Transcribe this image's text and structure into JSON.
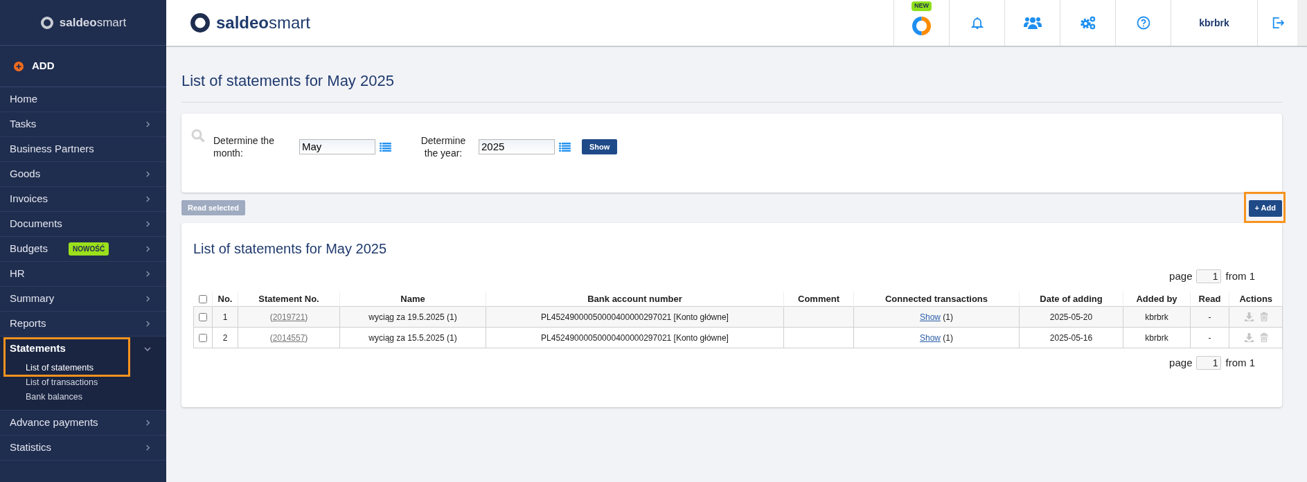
{
  "sidebar": {
    "logo": "**saldeo**smart",
    "add_label": "ADD",
    "items": [
      {
        "label": "Home",
        "has_arrow": false,
        "expanded": false,
        "highlighted": false
      },
      {
        "label": "Tasks",
        "has_arrow": true,
        "expanded": false,
        "highlighted": false
      },
      {
        "label": "Business Partners",
        "has_arrow": false,
        "expanded": false,
        "highlighted": false
      },
      {
        "label": "Goods",
        "has_arrow": true,
        "expanded": false,
        "highlighted": false
      },
      {
        "label": "Invoices",
        "has_arrow": true,
        "expanded": false,
        "highlighted": false
      },
      {
        "label": "Documents",
        "has_arrow": true,
        "expanded": false,
        "highlighted": false
      },
      {
        "label": "Budgets",
        "badge": "NOWOŚĆ",
        "has_arrow": true,
        "expanded": false,
        "highlighted": false
      },
      {
        "label": "HR",
        "has_arrow": true,
        "expanded": false,
        "highlighted": false
      },
      {
        "label": "Summary",
        "has_arrow": true,
        "expanded": false,
        "highlighted": false
      },
      {
        "label": "Reports",
        "has_arrow": true,
        "expanded": false,
        "highlighted": false
      },
      {
        "label": "Statements",
        "has_arrow": true,
        "expanded": true,
        "highlighted": true,
        "children": [
          {
            "label": "List of statements",
            "selected": true
          },
          {
            "label": "List of transactions",
            "selected": false
          },
          {
            "label": "Bank balances",
            "selected": false
          }
        ]
      },
      {
        "label": "Advance payments",
        "has_arrow": true,
        "expanded": false,
        "highlighted": false
      },
      {
        "label": "Statistics",
        "has_arrow": true,
        "expanded": false,
        "highlighted": false
      }
    ]
  },
  "header": {
    "logo": "**saldeo**smart",
    "new_badge": "NEW",
    "username": "kbrbrk"
  },
  "page_title": "List of statements for May 2025",
  "filter": {
    "month_label": "Determine the month:",
    "month_value": "May",
    "year_label": "Determine the year:",
    "year_value": "2025",
    "show_button": "Show"
  },
  "read_selected_button": {
    "label": "Read selected",
    "disabled": true
  },
  "add_button": {
    "label": "+ Add",
    "highlighted": true
  },
  "list": {
    "title": "List of statements for May 2025",
    "all_checked": false,
    "pager_top": {
      "prefix": "page",
      "page": "1",
      "suffix": "from 1"
    },
    "columns": [
      "No.",
      "Statement No.",
      "Name",
      "Bank account number",
      "Comment",
      "Connected transactions",
      "Date of adding",
      "Added by",
      "Read",
      "Actions"
    ],
    "rows": [
      {
        "checked": false,
        "no": "1",
        "statement_no": {
          "before": "(",
          "link": "2019721",
          "after": ")"
        },
        "name": "wyciąg za 19.5.2025 (1)",
        "account": "PL45249000050000400000297021 [Konto główne]",
        "connected": {
          "link": "Show",
          "after": "(1)"
        },
        "date": "2025-05-20",
        "added_by": "kbrbrk",
        "read": "-"
      },
      {
        "checked": false,
        "no": "2",
        "statement_no": {
          "before": "(",
          "link": "2014557",
          "after": ")"
        },
        "name": "wyciąg za 15.5.2025 (1)",
        "account": "PL45249000050000400000297021 [Konto główne]",
        "connected": {
          "link": "Show",
          "after": "(1)"
        },
        "date": "2025-05-16",
        "added_by": "kbrbrk",
        "read": "-"
      }
    ],
    "pager_bottom": {
      "prefix": "page",
      "page": "1",
      "suffix": "from 1"
    }
  }
}
